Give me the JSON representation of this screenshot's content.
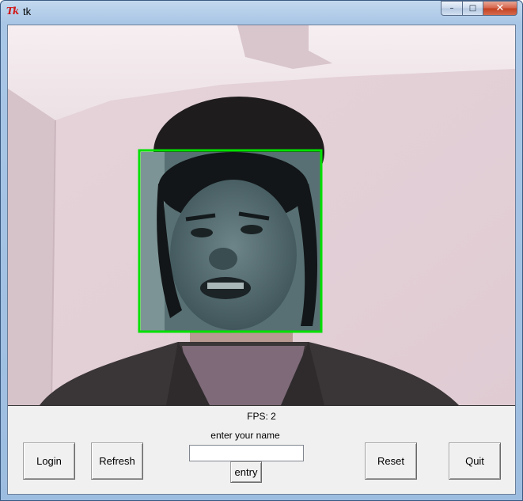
{
  "window": {
    "title": "tk",
    "logo_text": "Tk",
    "caption_buttons": {
      "minimize": "–",
      "maximize": "□",
      "close": "✕"
    }
  },
  "status": {
    "fps": "FPS: 2"
  },
  "name_prompt": "enter your name",
  "name_input": {
    "value": "",
    "placeholder": ""
  },
  "buttons": {
    "login": "Login",
    "refresh": "Refresh",
    "entry": "entry",
    "reset": "Reset",
    "quit": "Quit"
  },
  "face_detection": {
    "box_color": "#00e000"
  },
  "icons": [
    "tk-logo-icon",
    "minimize-icon",
    "maximize-icon",
    "close-icon"
  ]
}
